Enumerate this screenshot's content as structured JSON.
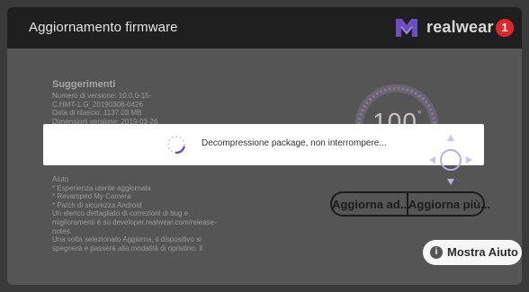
{
  "header": {
    "title": "Aggiornamento firmware",
    "brand": "realwear",
    "notification_count": "1",
    "brand_icon": "realwear-logo-icon",
    "colors": {
      "topbar": "#1f1f20",
      "badge": "#e0262a",
      "logo": "#7a56c8"
    }
  },
  "info": {
    "heading": "Suggerimenti",
    "lines": [
      "Numero di versione: 10.0.0-15-",
      "C.HMT-1.G_20190308-0426",
      "Data di rilascio: 1137.03 MB",
      "Dimensioni versione: 2019-03-26"
    ],
    "lower_lines": [
      "Aiuto",
      "* Esperienza utente aggiornata",
      "* Revamped My Camera",
      "* Patch di sicurezza Android",
      "Un elenco dettagliato di correzioni di bug e",
      "miglioramenti è su developer.realwear.com/release-",
      "notes.",
      "Una volta selezionato Aggiorna, il dispositivo si",
      "spegnerà e passerà alla modalità di ripristino. Il"
    ]
  },
  "gauge": {
    "value": "100",
    "unit_mark": "°"
  },
  "dialog": {
    "message": "Decompressione package, non interrompere...",
    "icon": "loading-spinner-icon"
  },
  "nav_pad": {
    "icon": "navigation-pad-icon",
    "accent": "#b7aee6"
  },
  "buttons": {
    "update_now": "Aggiorna ad...",
    "update_later": "Aggiorna più..."
  },
  "help": {
    "label": "Mostra Aiuto",
    "icon": "info-icon"
  }
}
